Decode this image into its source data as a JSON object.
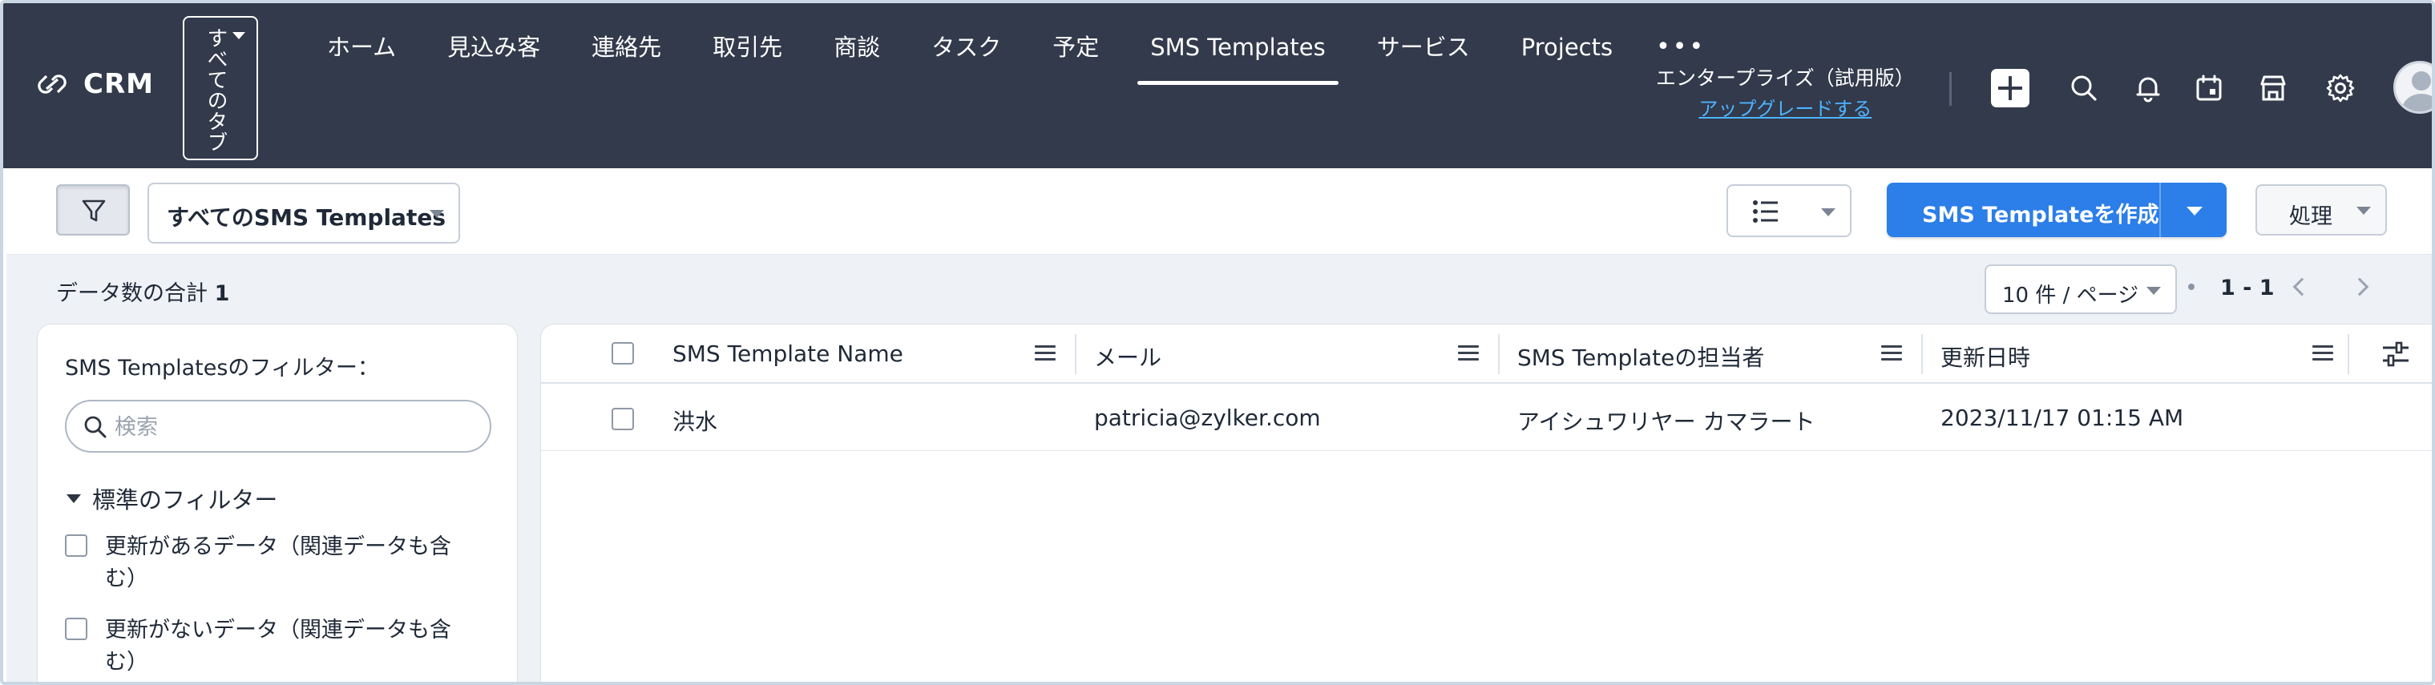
{
  "app": {
    "logo_text": "CRM",
    "all_tabs_label": "すべてのタブ",
    "nav": [
      {
        "label": "ホーム",
        "active": false
      },
      {
        "label": "見込み客",
        "active": false
      },
      {
        "label": "連絡先",
        "active": false
      },
      {
        "label": "取引先",
        "active": false
      },
      {
        "label": "商談",
        "active": false
      },
      {
        "label": "タスク",
        "active": false
      },
      {
        "label": "予定",
        "active": false
      },
      {
        "label": "SMS Templates",
        "active": true
      },
      {
        "label": "サービス",
        "active": false
      },
      {
        "label": "Projects",
        "active": false
      }
    ],
    "more_label": "•••",
    "edition": "エンタープライズ（試用版）",
    "upgrade_link": "アップグレードする",
    "icons": [
      "plus-icon",
      "search-icon",
      "bell-icon",
      "calendar-icon",
      "marketplace-icon",
      "gear-icon",
      "avatar"
    ]
  },
  "toolbar": {
    "view_label": "すべてのSMS Templates",
    "create_label": "SMS Templateを作成",
    "action_label": "処理",
    "accent_color": "#2c7ee8"
  },
  "summary": {
    "total_label": "データ数の合計",
    "total_count": "1",
    "per_page": "10 件 / ページ",
    "range": "1 - 1"
  },
  "filters": {
    "title": "SMS Templatesのフィルター：",
    "search_placeholder": "検索",
    "standard_label": "標準のフィルター",
    "items": [
      "更新があるデータ（関連データも含む）",
      "更新がないデータ（関連データも含む）"
    ]
  },
  "table": {
    "columns": [
      "SMS Template Name",
      "メール",
      "SMS Templateの担当者",
      "更新日時"
    ],
    "rows": [
      {
        "name": "洪水",
        "email": "patricia@zylker.com",
        "owner": "アイシュワリヤー カマラート",
        "modified": "2023/11/17 01:15 AM"
      }
    ]
  }
}
